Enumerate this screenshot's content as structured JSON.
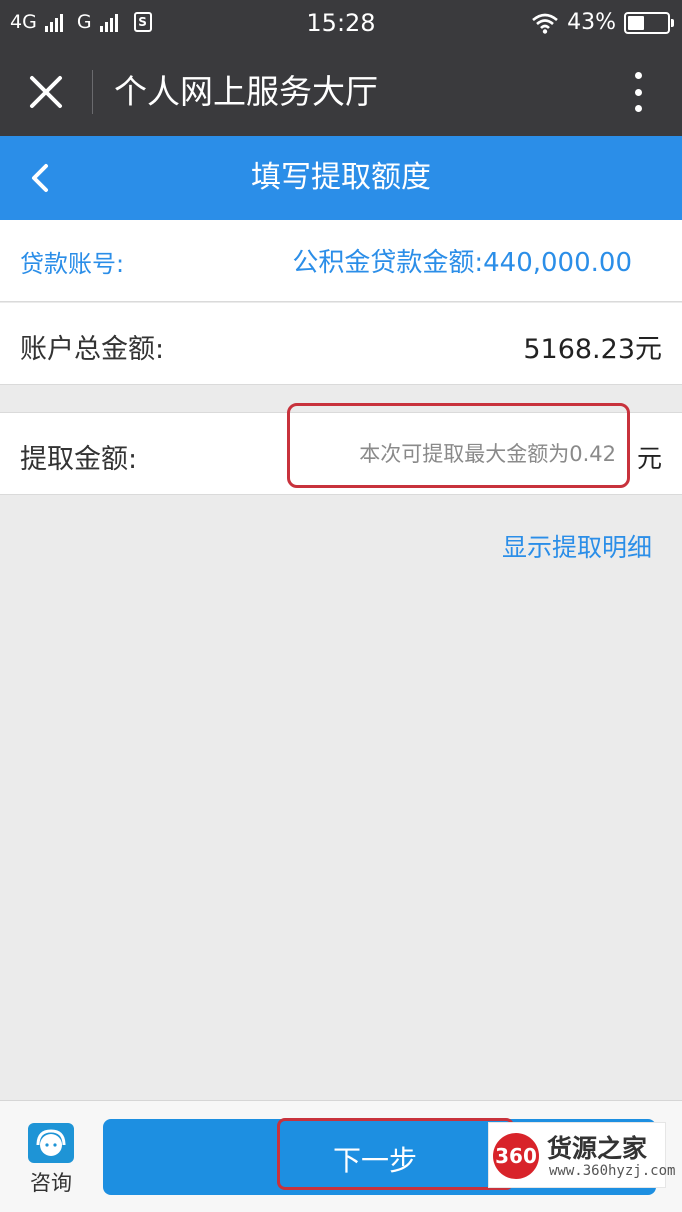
{
  "status_bar": {
    "network1": "4G",
    "network2": "G",
    "sim_icon_text": "S",
    "time": "15:28",
    "battery": "43%",
    "battery_level": 0.43
  },
  "titlebar": {
    "title": "个人网上服务大厅",
    "close_icon": "close-icon",
    "more_icon": "more-vertical-icon"
  },
  "header": {
    "title": "填写提取额度",
    "back_icon": "chevron-left-icon"
  },
  "loan": {
    "account_label": "贷款账号:",
    "amount_text": "公积金贷款金额:440,000.00"
  },
  "account_total": {
    "label": "账户总金额:",
    "value": "5168.23元"
  },
  "withdraw": {
    "label": "提取金额:",
    "placeholder": "本次可提取最大金额为0.42",
    "unit": "元"
  },
  "detail_link": "显示提取明细",
  "bottom": {
    "consult_label": "咨询",
    "next_label": "下一步"
  },
  "watermark": {
    "logo": "360",
    "name": "货源之家",
    "url": "www.360hyzj.com"
  },
  "colors": {
    "brand_blue": "#2b8ee8",
    "dark_bar": "#3a3a3d",
    "annotation_red": "#c8323c"
  }
}
